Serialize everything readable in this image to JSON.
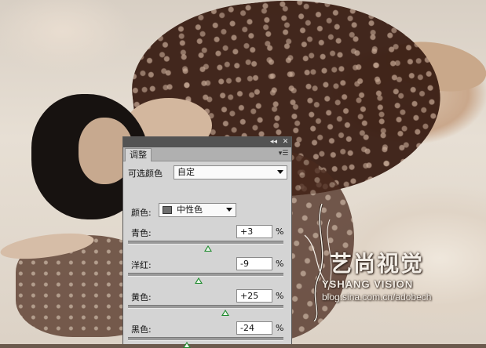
{
  "panel": {
    "tab_label": "调整",
    "collapse_icon": "double-chevron-icon",
    "close_icon": "close-icon",
    "menu_icon": "panel-menu-icon",
    "adjustment_name": "可选颜色",
    "preset_value": "自定",
    "colors_label": "颜色:",
    "colors_value": "中性色",
    "swatch_color": "#6e6e6e",
    "percent_unit": "%",
    "sliders": [
      {
        "label": "青色:",
        "value": "+3",
        "level": 3
      },
      {
        "label": "洋红:",
        "value": "-9",
        "level": -9
      },
      {
        "label": "黄色:",
        "value": "+25",
        "level": 25
      },
      {
        "label": "黑色:",
        "value": "-24",
        "level": -24
      }
    ]
  },
  "watermark": {
    "title": "艺尚视觉",
    "subtitle": "YSHANG VISION",
    "url": "blog.sina.com.cn/adobech"
  }
}
